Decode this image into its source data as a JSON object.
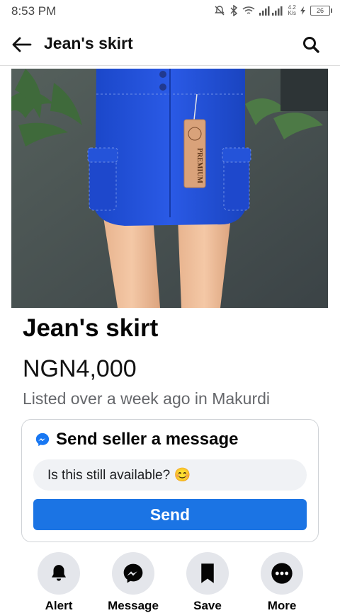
{
  "status_bar": {
    "time": "8:53 PM",
    "net_speed_value": "4.2",
    "net_speed_unit": "K/s",
    "battery": "26"
  },
  "header": {
    "title": "Jean's skirt"
  },
  "listing": {
    "tag_text": "PREMIUM",
    "title": "Jean's skirt",
    "price": "NGN4,000",
    "meta": "Listed over a week ago in Makurdi"
  },
  "message_card": {
    "title": "Send seller a message",
    "input_value": "Is this still available? 😊",
    "send_label": "Send"
  },
  "actions": [
    {
      "label": "Alert",
      "icon": "bell-icon"
    },
    {
      "label": "Message",
      "icon": "messenger-icon"
    },
    {
      "label": "Save",
      "icon": "bookmark-icon"
    },
    {
      "label": "More",
      "icon": "more-icon"
    }
  ],
  "colors": {
    "accent": "#1b74e4",
    "skirt": "#1f4fd8"
  }
}
